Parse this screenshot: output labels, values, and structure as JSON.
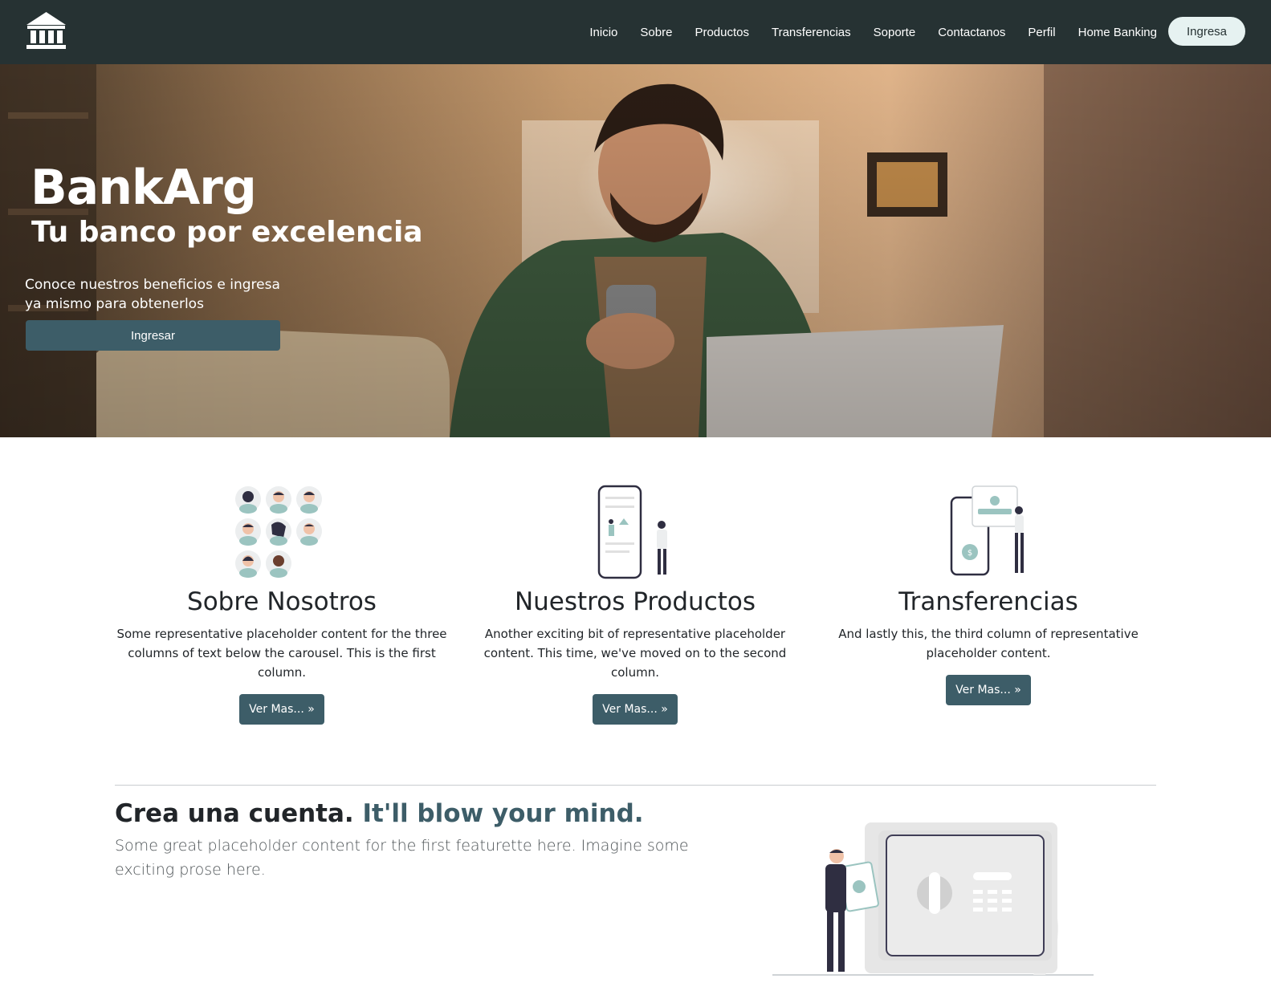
{
  "nav": {
    "items": [
      "Inicio",
      "Sobre",
      "Productos",
      "Transferencias",
      "Soporte",
      "Contactanos",
      "Perfil",
      "Home Banking"
    ],
    "cta": "Ingresa"
  },
  "hero": {
    "title": "BankArg",
    "subtitle": "Tu banco por excelencia",
    "text": "Conoce nuestros beneficios e ingresa ya mismo para obtenerlos",
    "button": "Ingresar"
  },
  "columns": [
    {
      "title": "Sobre Nosotros",
      "text": "Some representative placeholder content for the three columns of text below the carousel. This is the first column.",
      "button": "Ver Mas... »"
    },
    {
      "title": "Nuestros Productos",
      "text": "Another exciting bit of representative placeholder content. This time, we've moved on to the second column.",
      "button": "Ver Mas... »"
    },
    {
      "title": "Transferencias",
      "text": "And lastly this, the third column of representative placeholder content.",
      "button": "Ver Mas... »"
    }
  ],
  "featurette": {
    "heading": "Crea una cuenta.",
    "heading_accent": "It'll blow your mind.",
    "lead": "Some great placeholder content for the first featurette here. Imagine some exciting prose here."
  },
  "colors": {
    "navbar": "#263233",
    "accent": "#3d5d68",
    "cta_bg": "#e6f2f1"
  },
  "icons": {
    "logo": "bank-building-icon"
  }
}
